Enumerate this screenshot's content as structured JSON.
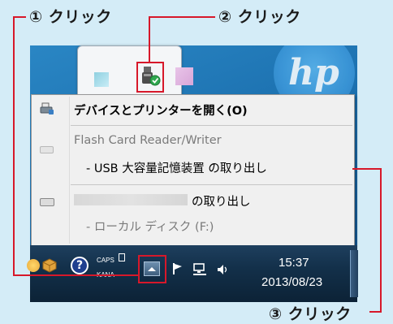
{
  "annotations": {
    "step1": "① クリック",
    "step2": "② クリック",
    "step3": "③ クリック"
  },
  "desktop": {
    "logo_text": "hp"
  },
  "menu": {
    "items": [
      {
        "label": "デバイスとプリンターを開く(O)",
        "icon": "devices-printers-icon",
        "enabled": true
      },
      {
        "label": "Flash Card Reader/Writer",
        "icon": "card-reader-icon",
        "enabled": false
      },
      {
        "label": "- USB 大容量記憶装置 の取り出し",
        "enabled": true
      },
      {
        "label": "の取り出し",
        "icon": "drive-icon",
        "enabled": true,
        "name_redacted": true
      },
      {
        "label": "- ローカル ディスク (F:)",
        "enabled": false
      }
    ]
  },
  "taskbar": {
    "caps_label": "CAPS",
    "kana_label": "KANA",
    "time": "15:37",
    "date": "2013/08/23"
  },
  "colors": {
    "highlight_red": "#d7182a",
    "taskbar": "#13304a",
    "menu_bg": "#f0f0f0"
  }
}
